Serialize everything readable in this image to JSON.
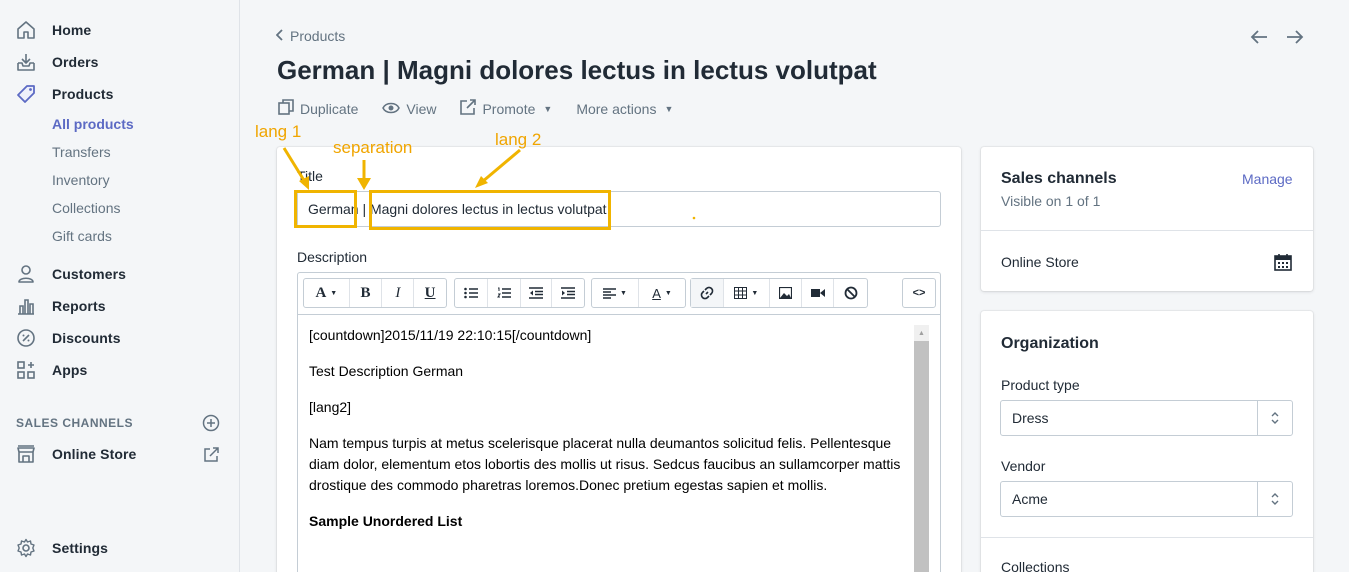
{
  "sidebar": {
    "nav": [
      {
        "label": "Home",
        "icon": "home-icon"
      },
      {
        "label": "Orders",
        "icon": "orders-icon"
      },
      {
        "label": "Products",
        "icon": "tag-icon"
      },
      {
        "label": "Customers",
        "icon": "customer-icon"
      },
      {
        "label": "Reports",
        "icon": "reports-icon"
      },
      {
        "label": "Discounts",
        "icon": "discount-icon"
      },
      {
        "label": "Apps",
        "icon": "apps-icon"
      }
    ],
    "product_sub": [
      "All products",
      "Transfers",
      "Inventory",
      "Collections",
      "Gift cards"
    ],
    "sales_channels_heading": "SALES CHANNELS",
    "online_store": "Online Store",
    "settings": "Settings"
  },
  "header": {
    "breadcrumb": "Products",
    "title": "German | Magni dolores lectus in lectus volutpat"
  },
  "actions": {
    "duplicate": "Duplicate",
    "view": "View",
    "promote": "Promote",
    "more": "More actions"
  },
  "form": {
    "title_label": "Title",
    "title_value": "German | Magni dolores lectus in lectus volutpat",
    "description_label": "Description",
    "editor": {
      "p1": "[countdown]2015/11/19 22:10:15[/countdown]",
      "p2": "Test Description German",
      "p3": "[lang2]",
      "p4": "Nam tempus turpis at metus scelerisque placerat nulla deumantos solicitud felis. Pellentesque diam dolor, elementum etos lobortis des mollis ut risus. Sedcus faucibus an sullamcorper mattis drostique des commodo pharetras loremos.Donec pretium egestas sapien et mollis.",
      "p5": "Sample Unordered List"
    },
    "toolbar": {
      "font": "A",
      "bold": "B",
      "italic": "I",
      "underline": "U",
      "color": "A",
      "code": "<>"
    }
  },
  "sales_channels": {
    "title": "Sales channels",
    "manage": "Manage",
    "visible": "Visible on 1 of 1",
    "online_store": "Online Store"
  },
  "organization": {
    "title": "Organization",
    "product_type_label": "Product type",
    "product_type": "Dress",
    "vendor_label": "Vendor",
    "vendor": "Acme",
    "collections_label": "Collections"
  },
  "annotations": {
    "lang1": "lang 1",
    "separation": "separation",
    "lang2": "lang 2",
    "color": "#f0a500"
  },
  "colors": {
    "accent": "#5c6ac4",
    "text": "#212b36",
    "muted": "#637381",
    "annotation": "#f0b400"
  }
}
